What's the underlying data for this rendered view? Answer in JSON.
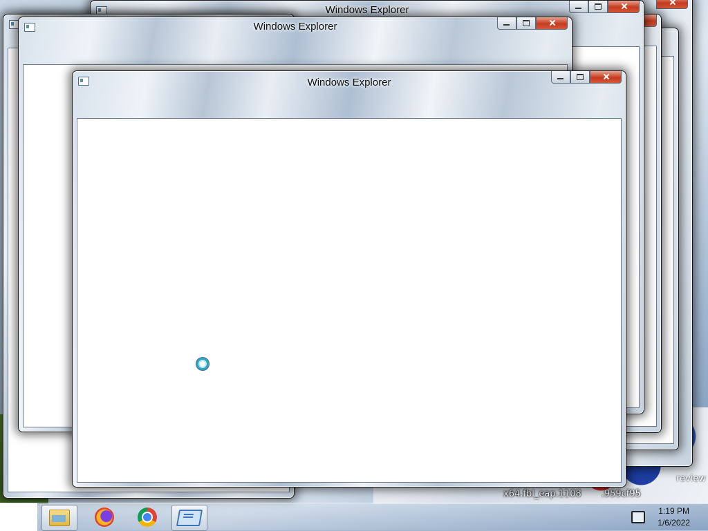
{
  "windows": [
    {
      "id": "back",
      "title": "Windows Explorer"
    },
    {
      "id": "middle",
      "title": "Windows Explorer"
    },
    {
      "id": "front",
      "title": "Windows Explorer"
    }
  ],
  "desktop": {
    "text_1": "x64.fbl_eap.1108",
    "text_2": ".959cf95",
    "text_3": "review"
  },
  "taskbar": {
    "buttons": [
      {
        "name": "windows-explorer",
        "icon": "folder-icon",
        "active": true
      },
      {
        "name": "firefox",
        "icon": "firefox-icon",
        "active": false
      },
      {
        "name": "chrome",
        "icon": "chrome-icon",
        "active": false
      },
      {
        "name": "explorer-app",
        "icon": "explorer-app-icon",
        "active": false
      }
    ],
    "clock_time": "1:19 PM",
    "clock_date": "1/6/2022"
  },
  "colors": {
    "close_button": "#c63a1f",
    "client_area": "#ffffff",
    "frame": "#1a1a1a"
  }
}
